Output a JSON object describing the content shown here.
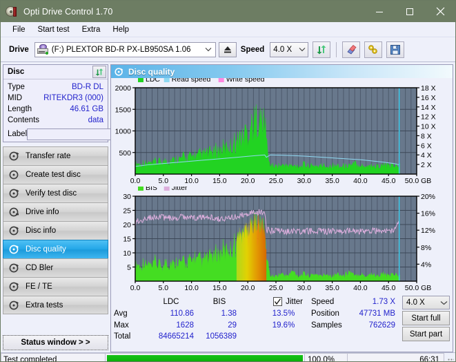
{
  "window": {
    "title": "Opti Drive Control 1.70",
    "icon": "disc-icon",
    "minimize_label": "–",
    "maximize_label": "□",
    "close_label": "✕"
  },
  "menu": {
    "items": [
      {
        "label": "File",
        "icon": ""
      },
      {
        "label": "Start test",
        "icon": ""
      },
      {
        "label": "Extra",
        "icon": ""
      },
      {
        "label": "Help",
        "icon": ""
      }
    ]
  },
  "toolbar": {
    "drive_label": "Drive",
    "drive_value": "(F:)  PLEXTOR BD-R  PX-LB950SA 1.06",
    "drive_icon": "optical-drive-icon",
    "eject_icon": "eject-icon",
    "speed_label": "Speed",
    "speed_value": "4.0 X",
    "refresh_icon": "refresh-icon",
    "erase_icon": "eraser-icon",
    "tools_icon": "wrench-icon",
    "save_icon": "floppy-save-icon"
  },
  "sidebar": {
    "disc_panel": {
      "title": "Disc",
      "refresh_icon": "refresh-icon",
      "rows": [
        {
          "key": "Type",
          "value": "BD-R DL"
        },
        {
          "key": "MID",
          "value": "RITEKDR3 (000)"
        },
        {
          "key": "Length",
          "value": "46.61 GB"
        },
        {
          "key": "Contents",
          "value": "data"
        }
      ],
      "label_key": "Label",
      "label_value": "",
      "label_placeholder": "",
      "label_icon": "disc-icon"
    },
    "nav": [
      {
        "label": "Transfer rate",
        "icon": "disc-test-icon",
        "active": false
      },
      {
        "label": "Create test disc",
        "icon": "disc-burn-icon",
        "active": false
      },
      {
        "label": "Verify test disc",
        "icon": "disc-verify-icon",
        "active": false
      },
      {
        "label": "Drive info",
        "icon": "drive-info-icon",
        "active": false
      },
      {
        "label": "Disc info",
        "icon": "disc-info-icon",
        "active": false
      },
      {
        "label": "Disc quality",
        "icon": "disc-quality-icon",
        "active": true
      },
      {
        "label": "CD Bler",
        "icon": "cd-bler-icon",
        "active": false
      },
      {
        "label": "FE / TE",
        "icon": "fe-te-icon",
        "active": false
      },
      {
        "label": "Extra tests",
        "icon": "extra-tests-icon",
        "active": false
      }
    ],
    "status_window_button": "Status window > >"
  },
  "panel": {
    "title": "Disc quality",
    "icon": "disc-quality-icon"
  },
  "stats": {
    "col_headers": [
      "LDC",
      "BIS",
      "Jitter"
    ],
    "row_labels": [
      "Avg",
      "Max",
      "Total"
    ],
    "ldc": {
      "avg": "110.86",
      "max": "1628",
      "total": "84665214"
    },
    "bis": {
      "avg": "1.38",
      "max": "29",
      "total": "1056389"
    },
    "jitter": {
      "label": "Jitter",
      "checked": true,
      "avg": "13.5%",
      "max": "19.6%"
    },
    "speed_key": "Speed",
    "speed_value": "1.73 X",
    "position_key": "Position",
    "position_value": "47731 MB",
    "samples_key": "Samples",
    "samples_value": "762629",
    "speed_select_value": "4.0 X",
    "start_full_label": "Start full",
    "start_part_label": "Start part"
  },
  "statusbar": {
    "message": "Test completed",
    "progress_percent": "100.0%",
    "progress_value": 100,
    "elapsed": "66:31"
  },
  "colors": {
    "titlebar": "#6d7d63",
    "plot_bg": "#68788c",
    "ldc_green": "#22d322",
    "read_speed": "#8fd9f2",
    "write_speed": "#ff88e0",
    "bis_green": "#44dd22",
    "jitter_pink": "#dcaedc",
    "accent_blue": "#2222cc",
    "nav_active": "#22a6e8",
    "progress_green": "#06a906"
  },
  "chart_data": [
    {
      "type": "area",
      "name": "disc-quality-ldc-chart",
      "title": "",
      "xlabel": "GB",
      "ylabel": "LDC",
      "xlim": [
        0,
        50
      ],
      "ylim": [
        0,
        2000
      ],
      "y2lim": [
        0,
        18
      ],
      "y2label": "X",
      "xticks": [
        "0.0",
        "5.0",
        "10.0",
        "15.0",
        "20.0",
        "25.0",
        "30.0",
        "35.0",
        "40.0",
        "45.0",
        "50.0 GB"
      ],
      "yticks": [
        500,
        1000,
        1500,
        2000
      ],
      "y2ticks": [
        "2 X",
        "4 X",
        "6 X",
        "8 X",
        "10 X",
        "12 X",
        "14 X",
        "16 X",
        "18 X"
      ],
      "grid": true,
      "legend": [
        "LDC",
        "Read speed",
        "Write speed"
      ],
      "legend_position": "top-left",
      "series": [
        {
          "name": "LDC",
          "kind": "area",
          "color": "#22d322",
          "x": [
            0.0,
            0.5,
            1.0,
            1.5,
            2.0,
            2.5,
            3.0,
            3.5,
            4.0,
            4.5,
            5.0,
            5.5,
            6.0,
            6.5,
            7.0,
            7.5,
            8.0,
            8.5,
            9.0,
            9.5,
            10.0,
            10.5,
            11.0,
            11.5,
            12.0,
            12.5,
            13.0,
            13.5,
            14.0,
            14.5,
            15.0,
            15.5,
            16.0,
            16.5,
            17.0,
            17.5,
            18.0,
            18.5,
            19.0,
            19.5,
            20.0,
            20.5,
            21.0,
            21.5,
            22.0,
            22.5,
            23.0,
            23.3,
            23.6,
            24.0,
            24.5,
            25.0,
            25.5,
            26.0,
            26.5,
            27.0,
            27.5,
            28.0,
            28.5,
            29.0,
            29.5,
            30.0,
            30.5,
            31.0,
            31.5,
            32.0,
            32.5,
            33.0,
            33.5,
            34.0,
            34.5,
            35.0,
            35.5,
            36.0,
            36.5,
            37.0,
            37.5,
            38.0,
            38.5,
            39.0,
            39.5,
            40.0,
            40.5,
            41.0,
            41.5,
            42.0,
            42.5,
            43.0,
            43.5,
            44.0,
            44.5,
            45.0,
            45.5,
            46.0,
            46.5,
            47.0
          ],
          "y": [
            250,
            290,
            230,
            310,
            260,
            300,
            250,
            330,
            280,
            350,
            300,
            380,
            320,
            400,
            350,
            420,
            380,
            450,
            400,
            470,
            430,
            500,
            450,
            520,
            480,
            560,
            500,
            600,
            540,
            650,
            580,
            700,
            620,
            780,
            700,
            860,
            780,
            980,
            900,
            1120,
            1050,
            1300,
            1250,
            1480,
            1400,
            1350,
            1250,
            1200,
            380,
            250,
            220,
            200,
            230,
            210,
            260,
            200,
            240,
            190,
            230,
            220,
            200,
            260,
            210,
            230,
            200,
            240,
            190,
            220,
            230,
            200,
            210,
            250,
            200,
            230,
            190,
            220,
            200,
            260,
            210,
            290,
            230,
            260,
            200,
            230,
            210,
            240,
            190,
            220,
            200,
            230,
            250,
            200,
            220,
            240,
            210,
            230
          ]
        },
        {
          "name": "Read speed",
          "kind": "line",
          "color": "#8fd9f2",
          "axis": "y2",
          "x": [
            0.0,
            2.0,
            4.0,
            6.0,
            8.0,
            10.0,
            12.0,
            14.0,
            16.0,
            18.0,
            20.0,
            22.0,
            23.0,
            23.3,
            24.0,
            26.0,
            28.0,
            30.0,
            32.0,
            34.0,
            36.0,
            38.0,
            40.0,
            42.0,
            44.0,
            46.0,
            47.0
          ],
          "y": [
            1.6,
            1.9,
            2.1,
            2.3,
            2.5,
            2.7,
            2.9,
            3.1,
            3.3,
            3.5,
            3.7,
            3.9,
            4.0,
            3.5,
            4.0,
            3.95,
            3.85,
            3.75,
            3.6,
            3.45,
            3.3,
            3.15,
            3.0,
            2.75,
            2.5,
            2.2,
            1.9
          ]
        },
        {
          "name": "Write speed",
          "kind": "line",
          "color": "#ff88e0",
          "axis": "y2",
          "x": [],
          "y": []
        },
        {
          "name": "End marker",
          "kind": "vline",
          "color": "#44d8f8",
          "x": 46.9
        }
      ]
    },
    {
      "type": "area",
      "name": "disc-quality-bis-jitter-chart",
      "title": "",
      "xlabel": "GB",
      "ylabel": "BIS",
      "xlim": [
        0,
        50
      ],
      "ylim": [
        0,
        30
      ],
      "y2lim": [
        0,
        20
      ],
      "y2label": "%",
      "xticks": [
        "0.0",
        "5.0",
        "10.0",
        "15.0",
        "20.0",
        "25.0",
        "30.0",
        "35.0",
        "40.0",
        "45.0",
        "50.0 GB"
      ],
      "yticks": [
        5,
        10,
        15,
        20,
        25,
        30
      ],
      "y2ticks": [
        "4%",
        "8%",
        "12%",
        "16%",
        "20%"
      ],
      "grid": true,
      "legend": [
        "BIS",
        "Jitter"
      ],
      "legend_position": "top-left",
      "series": [
        {
          "name": "BIS",
          "kind": "area",
          "color": "#44dd22",
          "x": [
            0.0,
            0.5,
            1.0,
            1.5,
            2.0,
            2.5,
            3.0,
            3.5,
            4.0,
            4.5,
            5.0,
            5.5,
            6.0,
            6.5,
            7.0,
            7.5,
            8.0,
            8.5,
            9.0,
            9.5,
            10.0,
            10.5,
            11.0,
            11.5,
            12.0,
            12.5,
            13.0,
            13.5,
            14.0,
            14.5,
            15.0,
            15.5,
            16.0,
            16.5,
            17.0,
            17.5,
            18.0,
            18.5,
            19.0,
            19.5,
            20.0,
            20.5,
            21.0,
            21.5,
            22.0,
            22.5,
            23.0,
            23.3,
            24.0,
            25.0,
            26.0,
            27.0,
            28.0,
            29.0,
            30.0,
            31.0,
            32.0,
            33.0,
            34.0,
            35.0,
            36.0,
            37.0,
            38.0,
            39.0,
            40.0,
            41.0,
            42.0,
            43.0,
            44.0,
            45.0,
            46.0,
            47.0
          ],
          "y": [
            6,
            7,
            5,
            8,
            6,
            7,
            5,
            8,
            6,
            7,
            5,
            9,
            6,
            8,
            6,
            9,
            7,
            8,
            6,
            9,
            7,
            10,
            8,
            9,
            7,
            10,
            8,
            11,
            9,
            12,
            10,
            13,
            11,
            14,
            12,
            15,
            14,
            17,
            16,
            19,
            18,
            21,
            20,
            22,
            21,
            20,
            18,
            10,
            2,
            2,
            3,
            2,
            4,
            2,
            3,
            2,
            3,
            2,
            3,
            2,
            3,
            2,
            4,
            2,
            3,
            2,
            3,
            2,
            3,
            2,
            3,
            2
          ]
        },
        {
          "name": "Jitter",
          "kind": "line",
          "color": "#dcaedc",
          "axis": "y2",
          "x": [
            0.0,
            1.0,
            2.0,
            3.0,
            4.0,
            5.0,
            6.0,
            7.0,
            8.0,
            9.0,
            10.0,
            11.0,
            12.0,
            13.0,
            14.0,
            15.0,
            16.0,
            17.0,
            18.0,
            19.0,
            20.0,
            21.0,
            22.0,
            23.0,
            23.3,
            24.0,
            25.0,
            26.0,
            27.0,
            28.0,
            29.0,
            30.0,
            31.0,
            32.0,
            33.0,
            34.0,
            35.0,
            36.0,
            37.0,
            38.0,
            39.0,
            40.0,
            41.0,
            42.0,
            43.0,
            44.0,
            45.0,
            46.0,
            46.9
          ],
          "y": [
            13.7,
            14.4,
            14.8,
            14.9,
            15.0,
            15.0,
            14.9,
            15.0,
            15.1,
            15.2,
            15.0,
            14.9,
            15.1,
            15.0,
            14.8,
            14.6,
            14.8,
            15.0,
            15.2,
            15.6,
            16.0,
            16.4,
            16.2,
            15.8,
            12.0,
            11.9,
            11.8,
            11.8,
            11.7,
            11.8,
            11.8,
            11.7,
            11.8,
            11.9,
            11.8,
            11.7,
            11.8,
            11.8,
            11.9,
            11.8,
            11.9,
            11.8,
            11.9,
            11.8,
            11.9,
            11.8,
            11.8,
            11.9,
            14.2
          ]
        },
        {
          "name": "End marker",
          "kind": "vline",
          "color": "#44d8f8",
          "x": 46.9
        }
      ]
    }
  ]
}
